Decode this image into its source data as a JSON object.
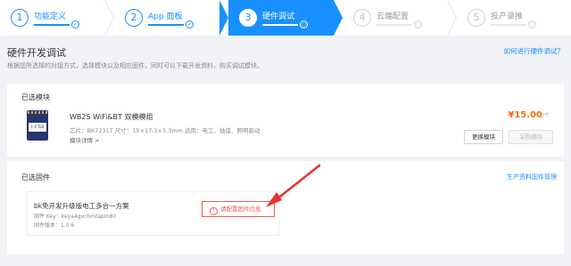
{
  "steps": [
    {
      "num": "1",
      "label": "功能定义",
      "check": "✓",
      "state": "done"
    },
    {
      "num": "2",
      "label": "App 面板",
      "check": "✓",
      "state": "done"
    },
    {
      "num": "3",
      "label": "硬件调试",
      "check": "○",
      "state": "active"
    },
    {
      "num": "4",
      "label": "云端配置",
      "check": "○",
      "state": "future"
    },
    {
      "num": "5",
      "label": "投产录推",
      "check": "○",
      "state": "future"
    }
  ],
  "header": {
    "title": "硬件开发调试",
    "description": "根据您所选择的对接方式，选择模块以及相应固件，同时可以下载开发资料，购买调试模块。",
    "help_link": "如何进行硬件调试？"
  },
  "module_section": {
    "label": "已选模块",
    "chip_text": "ℂ € ToS",
    "name": "WB2S WiFi&BT 双模模组",
    "spec": "芯片：BK7231T   尺寸：15×17.3×3.3mm   适用：电工、插座、照明驱动",
    "detail": "模块详情 >",
    "price": "¥15.00",
    "price_unit": "/个",
    "change_button": "更换模块",
    "buy_button": "采购模块"
  },
  "firmware_section": {
    "label": "已选固件",
    "prod_link": "生产资料固件管理",
    "name": "bk免开发升级版电工多合一方案",
    "key": "固件 Key：keya4gvchmtapm8n",
    "version": "固件版本：1.0.6",
    "config_button": "请配置固件信息"
  },
  "colors": {
    "primary": "#1890ff",
    "warning": "#f15a4a",
    "price": "#ff6a00"
  }
}
